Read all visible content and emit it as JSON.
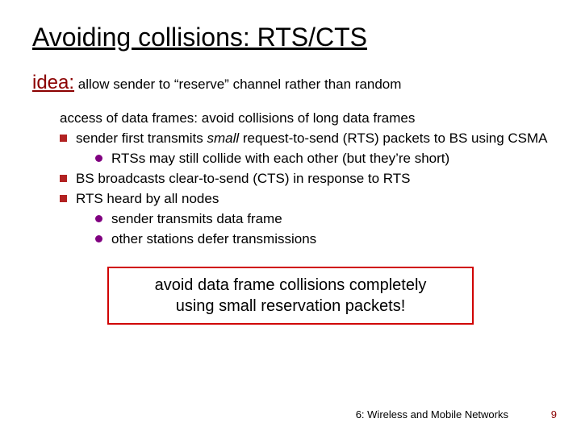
{
  "title": "Avoiding collisions: RTS/CTS",
  "idea_label": "idea:",
  "idea_text": " allow sender to “reserve” channel rather than random",
  "idea_cont": "access of data frames: avoid  collisions of long  data frames",
  "bullets": [
    {
      "pre": "sender first transmits ",
      "em": "small",
      "post": " request-to-send (RTS) packets to BS using CSMA",
      "subs": [
        "RTSs may still collide with each other (but they’re short)"
      ]
    },
    {
      "pre": "BS broadcasts clear-to-send (CTS) in response to RTS",
      "em": "",
      "post": "",
      "subs": []
    },
    {
      "pre": "RTS heard by all nodes",
      "em": "",
      "post": "",
      "subs": [
        "sender transmits data frame",
        "other stations defer transmissions"
      ]
    }
  ],
  "callout_l1": "avoid data frame collisions completely",
  "callout_l2": "using small reservation packets!",
  "footer_section": "6: Wireless and Mobile Networks",
  "page_num": "9"
}
